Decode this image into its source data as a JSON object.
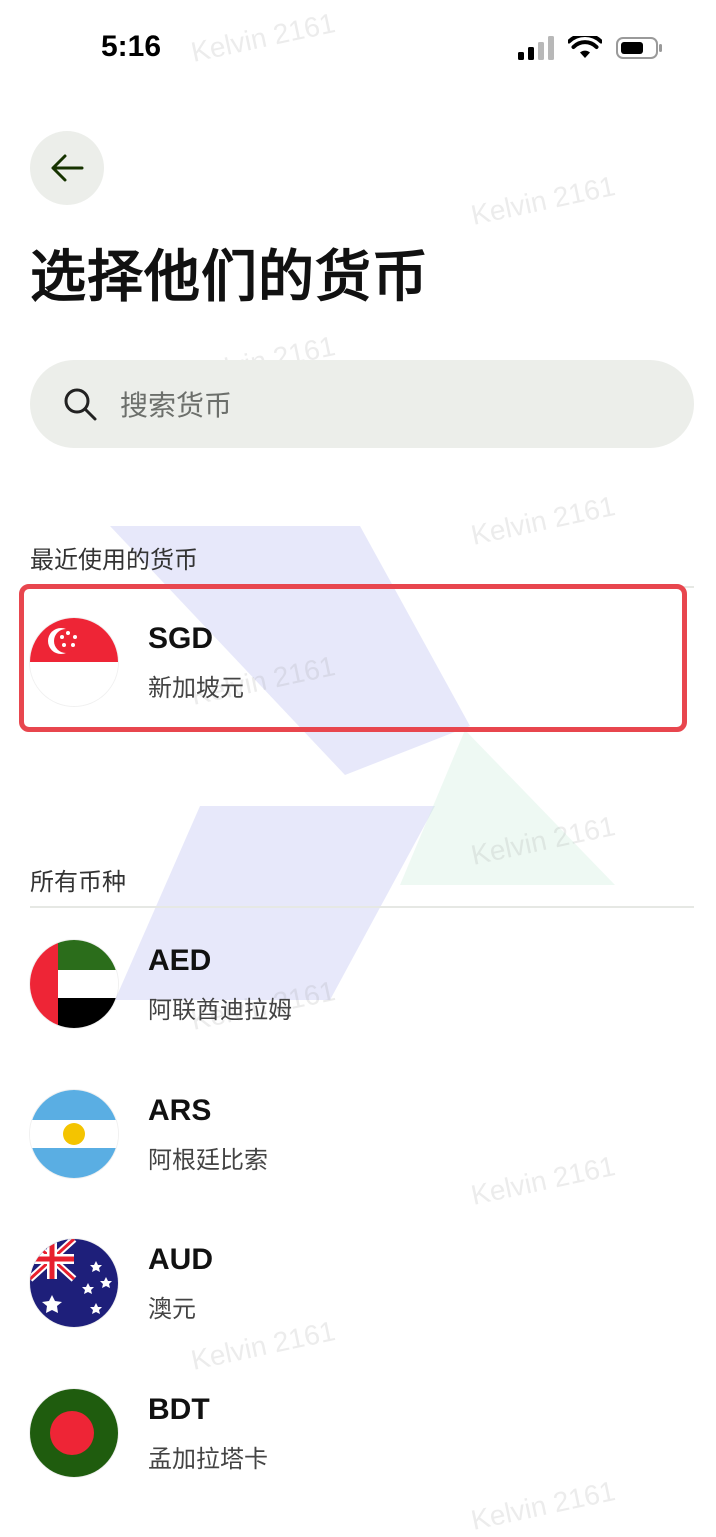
{
  "status_bar": {
    "time": "5:16"
  },
  "header": {
    "title": "选择他们的货币"
  },
  "search": {
    "placeholder": "搜索货币",
    "value": ""
  },
  "watermark": "Kelvin 2161",
  "recent": {
    "heading": "最近使用的货币",
    "items": [
      {
        "code": "SGD",
        "name": "新加坡元",
        "flag_icon": "singapore-flag"
      }
    ]
  },
  "all": {
    "heading": "所有币种",
    "items": [
      {
        "code": "AED",
        "name": "阿联酋迪拉姆",
        "flag_icon": "uae-flag"
      },
      {
        "code": "ARS",
        "name": "阿根廷比索",
        "flag_icon": "argentina-flag"
      },
      {
        "code": "AUD",
        "name": "澳元",
        "flag_icon": "australia-flag"
      },
      {
        "code": "BDT",
        "name": "孟加拉塔卡",
        "flag_icon": "bangladesh-flag"
      }
    ]
  },
  "colors": {
    "accent_bg": "#eceeea",
    "highlight": "#e8464e",
    "back_arrow": "#163300"
  }
}
